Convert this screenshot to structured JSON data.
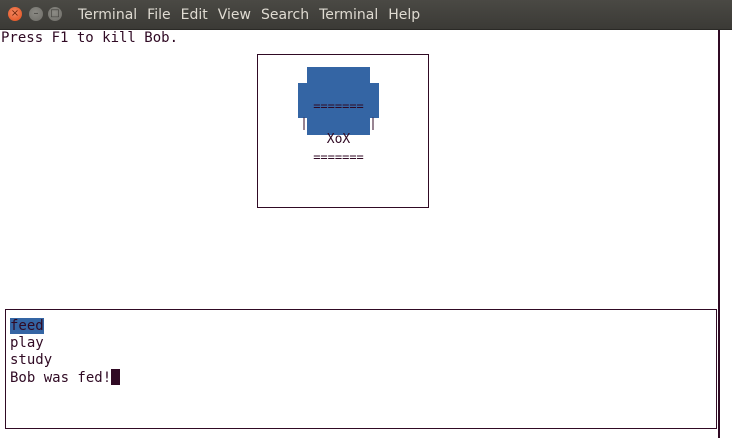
{
  "window": {
    "close_glyph": "×",
    "min_glyph": "–",
    "max_glyph": "□"
  },
  "menu": {
    "app": "Terminal",
    "items": [
      "File",
      "Edit",
      "View",
      "Search",
      "Terminal",
      "Help"
    ]
  },
  "terminal": {
    "header_line": "Press F1 to kill Bob.",
    "pet": {
      "top_border": "=======",
      "face": "XoX",
      "bottom_border": "=======",
      "side_left": "|",
      "side_right": "|"
    },
    "menu_options": [
      "feed",
      "play",
      "study"
    ],
    "selected_option": "feed",
    "status_message": "Bob was fed!"
  },
  "colors": {
    "terminal_fg": "#300a24",
    "selection_bg": "#3465a4",
    "pet_color": "#3465a4",
    "titlebar_bg": "#3c3b37"
  }
}
